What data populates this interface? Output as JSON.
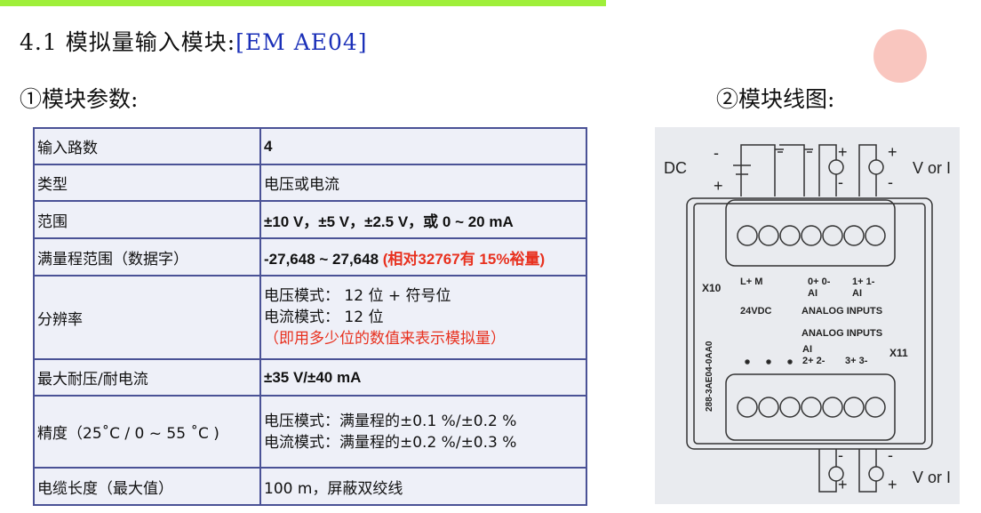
{
  "heading": {
    "prefix": "4.1 模拟量输入模块:",
    "model": "[EM AE04]"
  },
  "section1": "①模块参数:",
  "section2": "②模块线图:",
  "params": [
    {
      "key": "输入路数",
      "value": "4"
    },
    {
      "key": "类型",
      "value": "电压或电流"
    },
    {
      "key": "范围",
      "value": "±10 V，±5 V，±2.5 V，或 0 ~ 20 mA"
    },
    {
      "key": "满量程范围（数据字）",
      "value": "-27,648 ~ 27,648",
      "note": "(相对32767有 15%裕量)"
    },
    {
      "key": "分辨率",
      "lines": [
        "电压模式： 12 位 + 符号位",
        "电流模式： 12 位"
      ],
      "note": "（即用多少位的数值来表示模拟量）"
    },
    {
      "key": "最大耐压/耐电流",
      "value": "±35 V/±40 mA"
    },
    {
      "key": "精度（25˚C / 0 ~ 55 ˚C )",
      "lines": [
        "电压模式：满量程的±0.1 %/±0.2 %",
        "电流模式：满量程的±0.2 %/±0.3 %"
      ]
    },
    {
      "key": "电缆长度（最大值）",
      "value": "100 m，屏蔽双绞线"
    }
  ],
  "diagram": {
    "dc": "DC",
    "v_or_i": "V or I",
    "x10": "X10",
    "x11": "X11",
    "supply": "24VDC",
    "analog_inputs": "ANALOG INPUTS",
    "part_no": "288-3AE04-0AA0",
    "t_lm": "L+   M",
    "t_ai0": "0+  0-",
    "t_ai1": "1+  1-",
    "t_ai2": "2+  2-",
    "t_ai3": "3+  3-",
    "ai": "AI",
    "plus": "+",
    "minus": "-"
  }
}
